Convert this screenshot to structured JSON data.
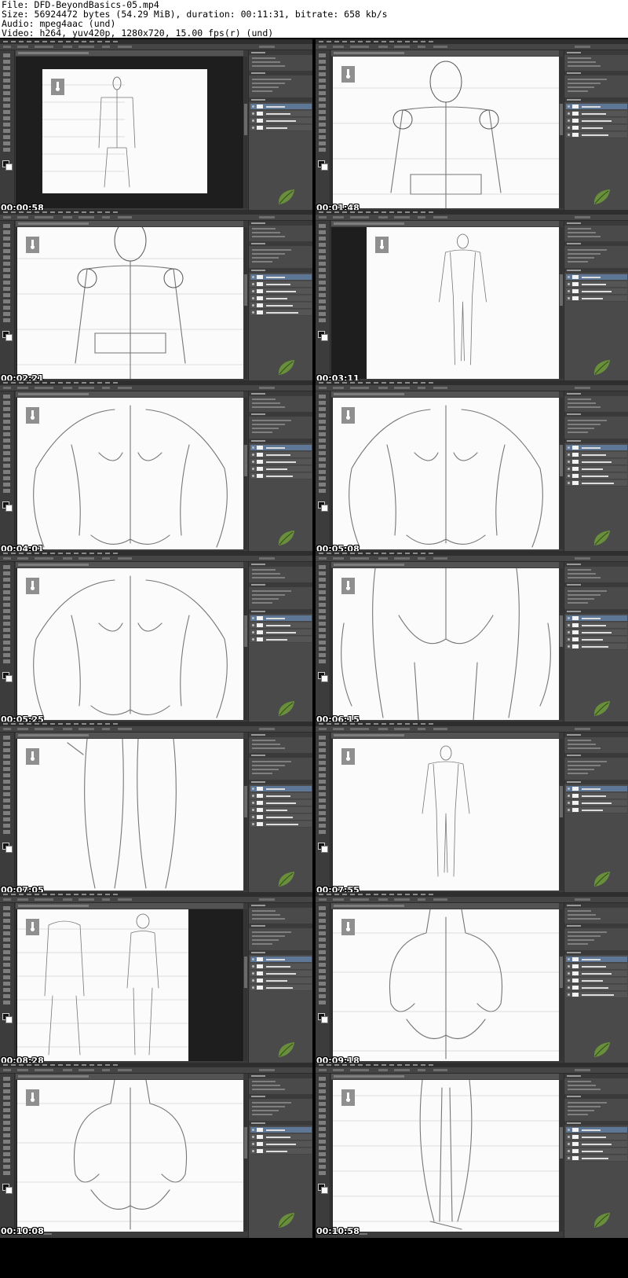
{
  "info": {
    "file": "File: DFD-BeyondBasics-05.mp4",
    "size": "Size: 56924472 bytes (54.29 MiB), duration: 00:11:31, bitrate: 658 kb/s",
    "audio": "Audio: mpeg4aac (und)",
    "video": "Video: h264, yuv420p, 1280x720, 15.00 fps(r) (und)"
  },
  "app": {
    "name": "Photoshop",
    "icon": "ps-icon"
  },
  "colors": {
    "background": "#000000",
    "ui_dark": "#3a3a3a",
    "canvas": "#fbfbfb",
    "selected_layer": "#5f7796",
    "leaf_accent": "#6f9a3a"
  },
  "frames": [
    {
      "timestamp": "00:00:58"
    },
    {
      "timestamp": "00:01:48"
    },
    {
      "timestamp": "00:02:21"
    },
    {
      "timestamp": "00:03:11"
    },
    {
      "timestamp": "00:04:01"
    },
    {
      "timestamp": "00:05:08"
    },
    {
      "timestamp": "00:05:25"
    },
    {
      "timestamp": "00:06:15"
    },
    {
      "timestamp": "00:07:05"
    },
    {
      "timestamp": "00:07:55"
    },
    {
      "timestamp": "00:08:28"
    },
    {
      "timestamp": "00:09:18"
    },
    {
      "timestamp": "00:10:08"
    },
    {
      "timestamp": "00:10:58"
    }
  ]
}
